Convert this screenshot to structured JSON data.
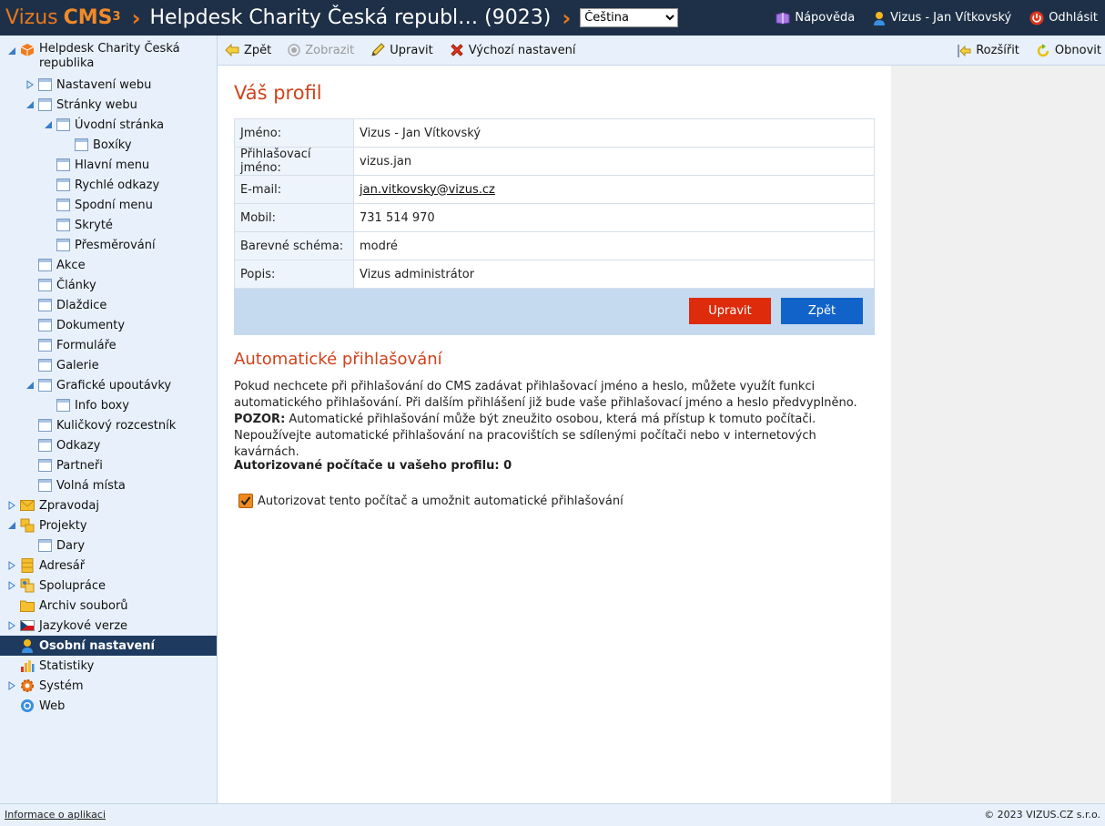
{
  "header": {
    "brand_name": "Vizus",
    "brand_product": "CMS",
    "brand_version": "3",
    "site_title": "Helpdesk Charity Česká republ… (9023)",
    "language_selected": "Čeština",
    "help_label": "Nápověda",
    "user_label": "Vizus - Jan Vítkovský",
    "logout_label": "Odhlásit"
  },
  "sidebar": {
    "items": [
      {
        "label": "Helpdesk Charity Česká",
        "label2": "republika"
      },
      {
        "label": "Nastavení webu"
      },
      {
        "label": "Stránky webu"
      },
      {
        "label": "Úvodní stránka"
      },
      {
        "label": "Boxíky"
      },
      {
        "label": "Hlavní menu"
      },
      {
        "label": "Rychlé odkazy"
      },
      {
        "label": "Spodní menu"
      },
      {
        "label": "Skryté"
      },
      {
        "label": "Přesměrování"
      },
      {
        "label": "Akce"
      },
      {
        "label": "Články"
      },
      {
        "label": "Dlaždice"
      },
      {
        "label": "Dokumenty"
      },
      {
        "label": "Formuláře"
      },
      {
        "label": "Galerie"
      },
      {
        "label": "Grafické upoutávky"
      },
      {
        "label": "Info boxy"
      },
      {
        "label": "Kuličkový rozcestník"
      },
      {
        "label": "Odkazy"
      },
      {
        "label": "Partneři"
      },
      {
        "label": "Volná místa"
      },
      {
        "label": "Zpravodaj"
      },
      {
        "label": "Projekty"
      },
      {
        "label": "Dary"
      },
      {
        "label": "Adresář"
      },
      {
        "label": "Spolupráce"
      },
      {
        "label": "Archiv souborů"
      },
      {
        "label": "Jazykové verze"
      },
      {
        "label": "Osobní nastavení"
      },
      {
        "label": "Statistiky"
      },
      {
        "label": "Systém"
      },
      {
        "label": "Web"
      }
    ]
  },
  "toolbar": {
    "back_label": "Zpět",
    "view_label": "Zobrazit",
    "edit_label": "Upravit",
    "defaults_label": "Výchozí nastavení",
    "expand_label": "Rozšířit",
    "refresh_label": "Obnovit"
  },
  "profile": {
    "title": "Váš profil",
    "rows": [
      {
        "label": "Jméno:",
        "value": "Vizus - Jan Vítkovský"
      },
      {
        "label": "Přihlašovací jméno:",
        "value": "vizus.jan"
      },
      {
        "label": "E-mail:",
        "value": "jan.vitkovsky@vizus.cz"
      },
      {
        "label": "Mobil:",
        "value": "731 514 970"
      },
      {
        "label": "Barevné schéma:",
        "value": "modré"
      },
      {
        "label": "Popis:",
        "value": "Vizus administrátor"
      }
    ],
    "edit_button": "Upravit",
    "back_button": "Zpět"
  },
  "autologin": {
    "title": "Automatické přihlašování",
    "text_part1": "Pokud nechcete při přihlašování do CMS zadávat přihlašovací jméno a heslo, můžete využít funkci automatického přihlašování. Při dalším přihlášení již bude vaše přihlašovací jméno a heslo předvyplněno.",
    "text_bold": "POZOR:",
    "text_part2": "Automatické přihlašování může být zneužito osobou, která má přístup k tomuto počítači. Nepoužívejte automatické přihlašování na pracovištích se sdílenými počítači nebo v internetových kavárnách.",
    "authorized_count": "Autorizované počítače u vašeho profilu: 0",
    "checkbox_label": "Autorizovat tento počítač a umožnit automatické přihlašování",
    "checkbox_checked": true
  },
  "footer": {
    "app_info_link": "Informace o aplikaci",
    "copyright": "© 2023 VIZUS.CZ s.r.o."
  }
}
